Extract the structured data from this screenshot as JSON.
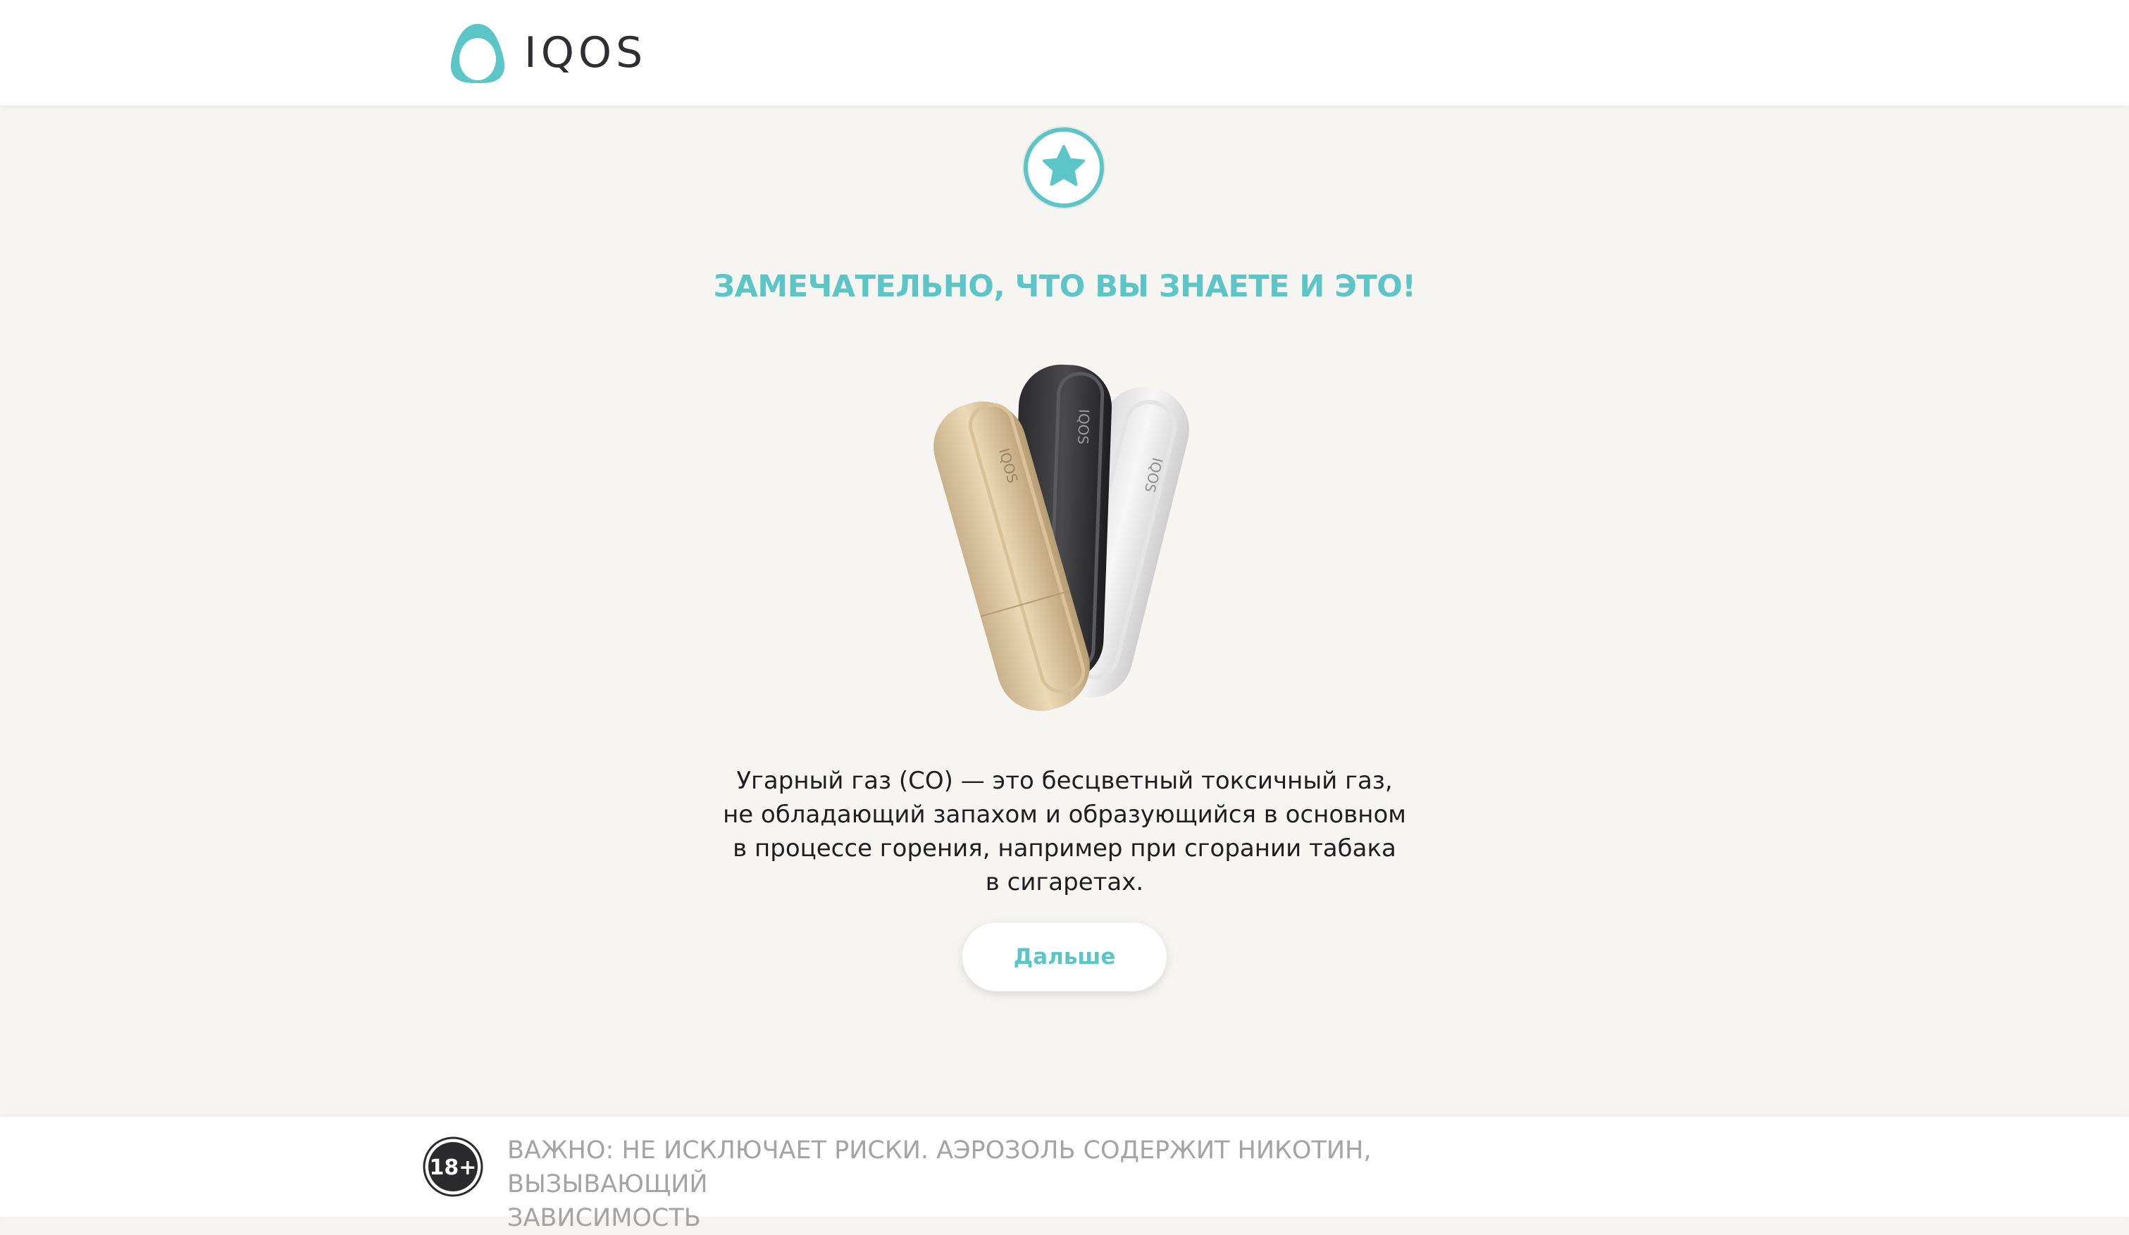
{
  "header": {
    "logo_text": "IQOS",
    "brand_color": "#5bc5c7"
  },
  "main": {
    "star_icon": "star-icon",
    "title": "ЗАМЕЧАТЕЛЬНО, ЧТО ВЫ ЗНАЕТЕ И ЭТО!",
    "product_image": "iqos-holders-image",
    "product_labels": [
      "IQOS",
      "IQOS",
      "IQOS"
    ],
    "body_lines": [
      "Угарный газ (СО) — это бесцветный токсичный газ,",
      "не обладающий запахом и образующийся в основном",
      "в процессе горения, например при сгорании табака",
      "в сигаретах."
    ],
    "next_button_label": "Дальше"
  },
  "footer": {
    "age_label": "18+",
    "warning_lines": [
      "ВАЖНО: НЕ ИСКЛЮЧАЕТ РИСКИ. АЭРОЗОЛЬ СОДЕРЖИТ НИКОТИН, ВЫЗЫВАЮЩИЙ",
      "ЗАВИСИМОСТЬ"
    ]
  }
}
